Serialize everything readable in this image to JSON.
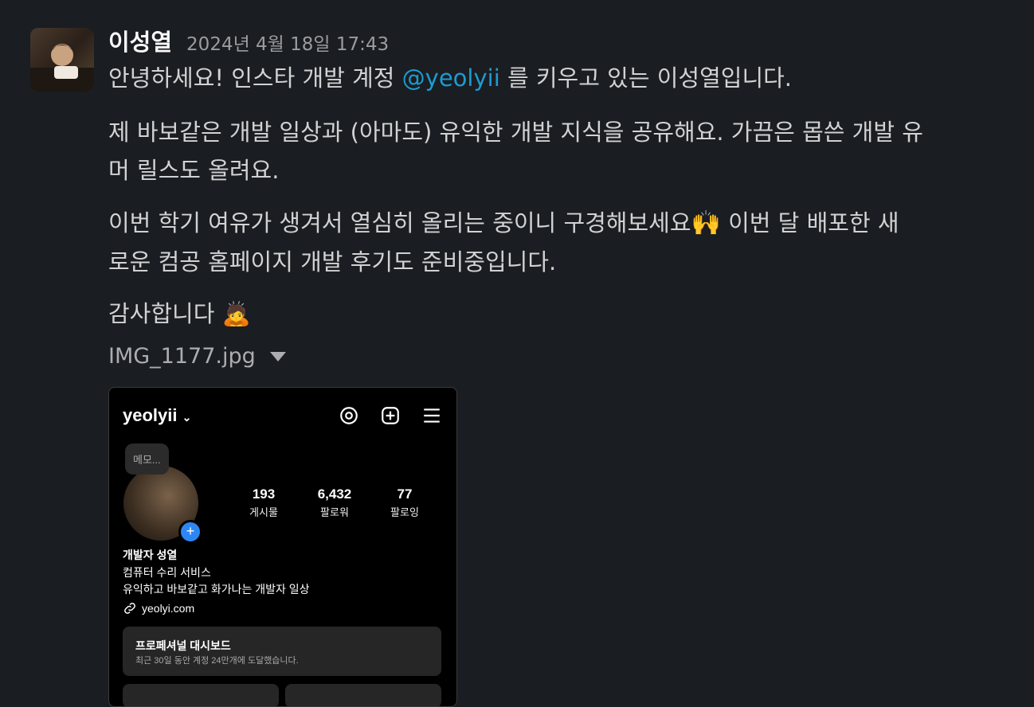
{
  "message": {
    "author": "이성열",
    "timestamp": "2024년 4월 18일 17:43",
    "p1_before": "안녕하세요! 인스타 개발 계정 ",
    "mention": "@yeolyii",
    "p1_after": " 를 키우고 있는 이성열입니다.",
    "p2_line1": "제 바보같은 개발 일상과 (아마도) 유익한 개발 지식을 공유해요. 가끔은 몹쓴 개발 유",
    "p2_line2": "머 릴스도 올려요.",
    "p3_line1_a": "이번 학기 여유가 생겨서 열심히 올리는 중이니 구경해보세요",
    "p3_emoji": "🙌",
    "p3_line1_b": " 이번 달 배포한 새",
    "p3_line2": "로운 컴공 홈페이지 개발 후기도 준비중입니다.",
    "p4": "감사합니다",
    "p4_emoji": "🙇",
    "attachment_name": "IMG_1177.jpg"
  },
  "instagram": {
    "username": "yeolyii",
    "memo": "메모...",
    "stats": [
      {
        "value": "193",
        "label": "게시물"
      },
      {
        "value": "6,432",
        "label": "팔로워"
      },
      {
        "value": "77",
        "label": "팔로잉"
      }
    ],
    "display_name": "개발자 성열",
    "bio_line1": "컴퓨터 수리 서비스",
    "bio_line2": "유익하고 바보같고 화가나는 개발자 일상",
    "link": "yeolyi.com",
    "dashboard_title": "프로페셔널 대시보드",
    "dashboard_sub": "최근 30일 동안 계정 24만개에 도달했습니다."
  },
  "colors": {
    "background": "#1a1d21",
    "mention": "#1d9bd1",
    "text": "#d1d2d3"
  }
}
